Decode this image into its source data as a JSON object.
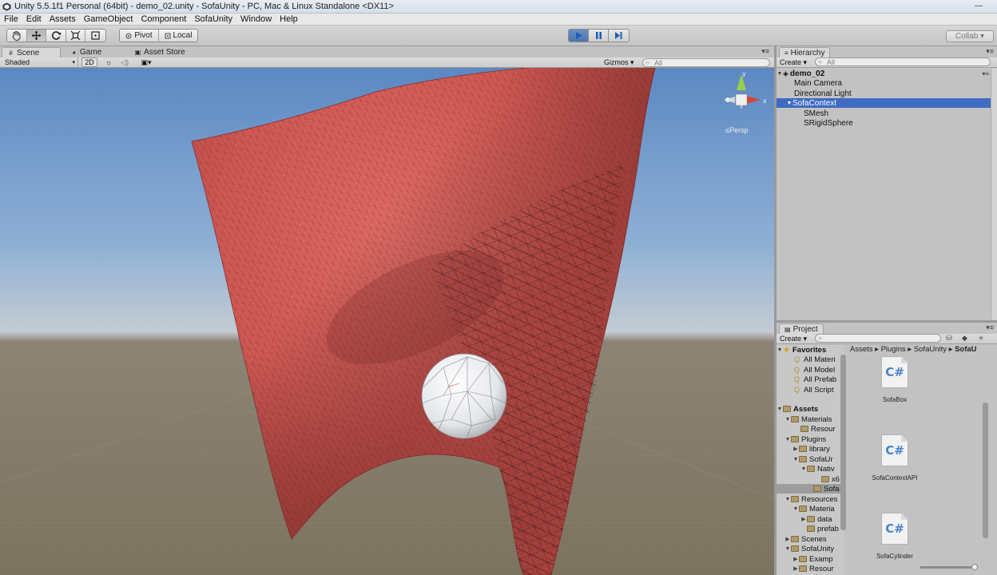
{
  "window": {
    "title": "Unity 5.5.1f1 Personal (64bit) - demo_02.unity - SofaUnity - PC, Mac & Linux Standalone <DX11>"
  },
  "menu": [
    "File",
    "Edit",
    "Assets",
    "GameObject",
    "Component",
    "SofaUnity",
    "Window",
    "Help"
  ],
  "toolbar": {
    "pivot_label": "Pivot",
    "local_label": "Local",
    "collab_label": "Collab ▾"
  },
  "scene_tabs": {
    "scene": "Scene",
    "game": "Game",
    "asset_store": "Asset Store"
  },
  "scene_bar": {
    "shading": "Shaded",
    "mode_2d": "2D",
    "gizmos": "Gizmos ▾",
    "search_placeholder": "All",
    "persp_label": "≤Persp"
  },
  "hierarchy": {
    "tab_label": "Hierarchy",
    "create_label": "Create ▾",
    "search_placeholder": "All",
    "scene_name": "demo_02",
    "items": [
      {
        "label": "Main Camera",
        "indent": 1,
        "selected": false
      },
      {
        "label": "Directional Light",
        "indent": 1,
        "selected": false
      },
      {
        "label": "SofaContext",
        "indent": 1,
        "selected": true
      },
      {
        "label": "SMesh",
        "indent": 2,
        "selected": false
      },
      {
        "label": "SRigidSphere",
        "indent": 2,
        "selected": false
      }
    ]
  },
  "project": {
    "tab_label": "Project",
    "create_label": "Create ▾",
    "breadcrumb": [
      "Assets",
      "Plugins",
      "SofaUnity",
      "SofaU"
    ],
    "favorites_label": "Favorites",
    "favorites": [
      "All Materi",
      "All Model",
      "All Prefab",
      "All Script"
    ],
    "assets_label": "Assets",
    "tree": [
      {
        "label": "Materials",
        "depth": 1
      },
      {
        "label": "Resour",
        "depth": 2
      },
      {
        "label": "Plugins",
        "depth": 1
      },
      {
        "label": "library",
        "depth": 2
      },
      {
        "label": "SofaUr",
        "depth": 2
      },
      {
        "label": "Nativ",
        "depth": 3
      },
      {
        "label": "x6",
        "depth": 4
      },
      {
        "label": "Sofa",
        "depth": 3
      },
      {
        "label": "Resources",
        "depth": 1
      },
      {
        "label": "Materia",
        "depth": 2
      },
      {
        "label": "data",
        "depth": 3
      },
      {
        "label": "prefab",
        "depth": 2
      },
      {
        "label": "Scenes",
        "depth": 1
      },
      {
        "label": "SofaUnity",
        "depth": 1
      },
      {
        "label": "Examp",
        "depth": 2
      },
      {
        "label": "Resour",
        "depth": 2
      }
    ],
    "asset_files": [
      {
        "name": "SofaBox",
        "glyph": "C#"
      },
      {
        "name": "SofaContextAPI",
        "glyph": "C#"
      },
      {
        "name": "SofaCylinder",
        "glyph": "C#"
      }
    ]
  },
  "colors": {
    "cloth": "#d9645e",
    "selection": "#3e6bc3",
    "play_active": "#4a73ad"
  }
}
